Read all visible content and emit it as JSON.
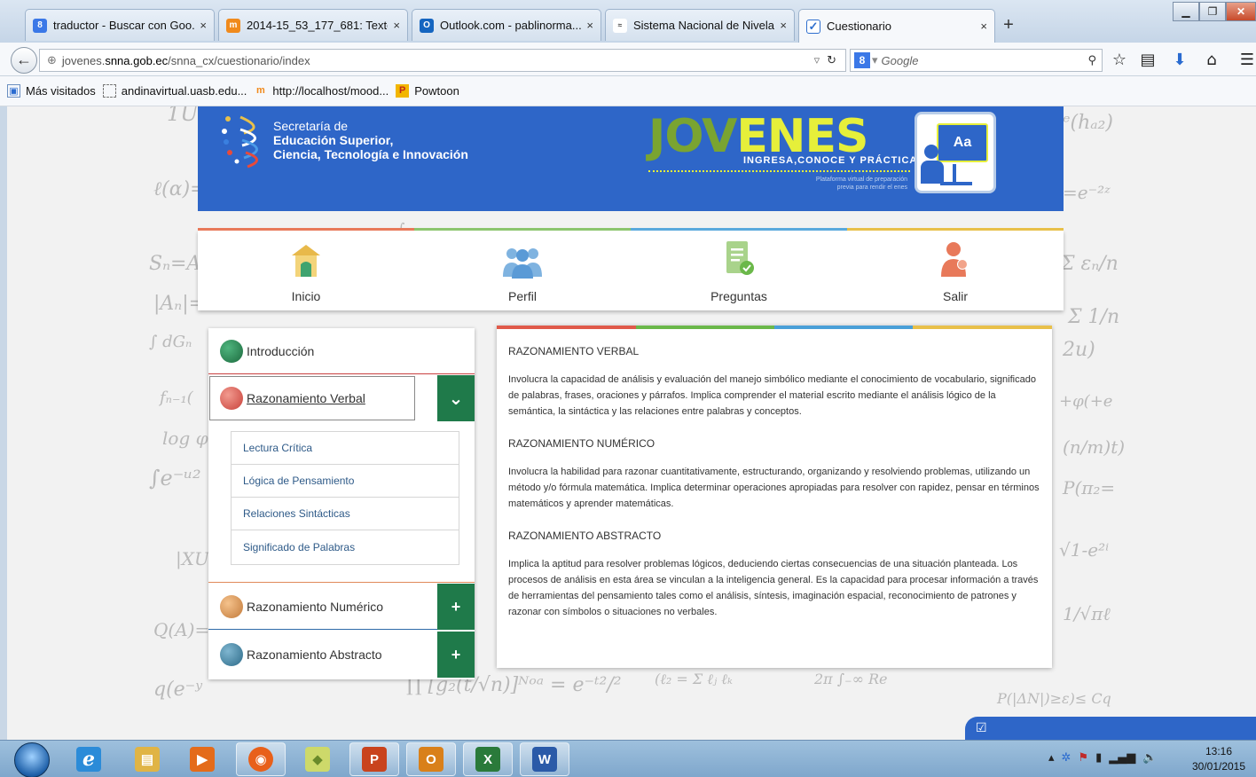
{
  "browser": {
    "tabs": [
      {
        "title": "traductor - Buscar con Goo...",
        "favicon": "google-icon",
        "color": "#3b78e7"
      },
      {
        "title": "2014-15_53_177_681: Texto...",
        "favicon": "moodle-icon",
        "color": "#f08a1c"
      },
      {
        "title": "Outlook.com - pablinorma...",
        "favicon": "outlook-icon",
        "color": "#1565c0"
      },
      {
        "title": "Sistema Nacional de Nivela...",
        "favicon": "snna-icon",
        "color": "#333333"
      },
      {
        "title": "Cuestionario",
        "favicon": "checkbox-icon",
        "color": "#2f6fce"
      }
    ],
    "close_glyph": "×",
    "new_tab": "+",
    "url_prefix": "jovenes.",
    "url_domain": "snna.gob.ec",
    "url_path": "/snna_cx/cuestionario/index",
    "search_engine": "Google",
    "bookmarks": [
      {
        "label": "Más visitados"
      },
      {
        "label": "andinavirtual.uasb.edu..."
      },
      {
        "label": "http://localhost/mood..."
      },
      {
        "label": "Powtoon"
      }
    ]
  },
  "banner": {
    "sec_line1": "Secretaría de",
    "sec_line2": "Educación Superior,",
    "sec_line3": "Ciencia, Tecnología e Innovación",
    "brand_a": "JOV",
    "brand_b": "ENES",
    "slogan": "INGRESA,CONOCE Y PRÁCTICA",
    "subslogan": "Plataforma virtual de preparación previa para rendir el enes",
    "board_text": "Aa"
  },
  "menu": {
    "items": [
      {
        "label": "Inicio",
        "icon": "home-icon"
      },
      {
        "label": "Perfil",
        "icon": "people-icon"
      },
      {
        "label": "Preguntas",
        "icon": "document-check-icon"
      },
      {
        "label": "Salir",
        "icon": "user-exit-icon"
      }
    ],
    "strip_colors": [
      "#e8795a",
      "#8cc56e",
      "#5aa9dd",
      "#e8c04a"
    ]
  },
  "sidebar": {
    "intro": "Introducción",
    "verbal": "Razonamiento Verbal",
    "verbal_subitems": [
      "Lectura Crítica",
      "Lógica de Pensamiento",
      "Relaciones Sintácticas",
      "Significado de Palabras"
    ],
    "numerico": "Razonamiento Numérico",
    "abstracto": "Razonamiento Abstracto",
    "expand_glyph": "+",
    "collapse_glyph": "⌄"
  },
  "content": {
    "sections": [
      {
        "title": "RAZONAMIENTO VERBAL",
        "text": "Involucra la capacidad de análisis y evaluación del manejo simbólico mediante el conocimiento de vocabulario, significado de palabras, frases, oraciones y párrafos. Implica comprender el material escrito mediante el análisis lógico de la semántica, la sintáctica y las relaciones entre palabras y conceptos."
      },
      {
        "title": "RAZONAMIENTO NUMÉRICO",
        "text": "Involucra la habilidad para razonar cuantitativamente, estructurando, organizando y resolviendo problemas, utilizando un método y/o fórmula matemática. Implica determinar operaciones apropiadas para resolver con rapidez, pensar en términos matemáticos y aprender matemáticas."
      },
      {
        "title": "RAZONAMIENTO ABSTRACTO",
        "text": "Implica la aptitud para resolver problemas lógicos, deduciendo ciertas consecuencias de una situación planteada. Los procesos de análisis en esta área se vinculan a la inteligencia general. Es la capacidad para procesar información a través de herramientas del pensamiento tales como el análisis, síntesis, imaginación espacial, reconocimiento de patrones y razonar con símbolos o situaciones no verbales."
      }
    ]
  },
  "chat": {
    "icon": "checkbox-icon",
    "glyph": "☑"
  },
  "taskbar": {
    "apps": [
      {
        "name": "ie-icon",
        "color": "#2b8bd8",
        "glyph": "e"
      },
      {
        "name": "explorer-icon",
        "color": "#e0b445",
        "glyph": "▤"
      },
      {
        "name": "media-player-icon",
        "color": "#e46b1a",
        "glyph": "▶"
      },
      {
        "name": "firefox-icon",
        "color": "#e8601a",
        "glyph": "◉"
      },
      {
        "name": "sticky-notes-icon",
        "color": "#cdd96a",
        "glyph": "◆"
      },
      {
        "name": "powerpoint-icon",
        "color": "#c9431d",
        "glyph": "P"
      },
      {
        "name": "outlook-icon",
        "color": "#d9801a",
        "glyph": "O"
      },
      {
        "name": "excel-icon",
        "color": "#2a7a3a",
        "glyph": "X"
      },
      {
        "name": "word-icon",
        "color": "#2a5aa8",
        "glyph": "W"
      }
    ],
    "time": "13:16",
    "date": "30/01/2015"
  }
}
